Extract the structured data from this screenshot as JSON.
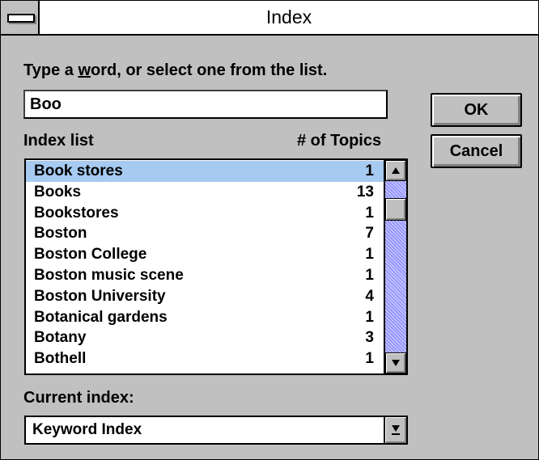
{
  "window": {
    "title": "Index"
  },
  "prompt": {
    "before": "Type a ",
    "accel": "w",
    "after": "ord, or select one from the list."
  },
  "search": {
    "value": "Boo"
  },
  "buttons": {
    "ok": "OK",
    "cancel": "Cancel"
  },
  "list_header": {
    "left": "Index list",
    "right": "# of Topics"
  },
  "index_list": [
    {
      "name": "Book stores",
      "count": "1",
      "selected": true
    },
    {
      "name": "Books",
      "count": "13"
    },
    {
      "name": "Bookstores",
      "count": "1"
    },
    {
      "name": "Boston",
      "count": "7"
    },
    {
      "name": "Boston College",
      "count": "1"
    },
    {
      "name": "Boston music scene",
      "count": "1"
    },
    {
      "name": "Boston University",
      "count": "4"
    },
    {
      "name": "Botanical gardens",
      "count": "1"
    },
    {
      "name": "Botany",
      "count": "3"
    },
    {
      "name": "Bothell",
      "count": "1"
    }
  ],
  "current_index": {
    "label": "Current index:",
    "value": "Keyword Index"
  },
  "icons": {
    "system_menu": "minus-bar-icon",
    "scroll_up": "arrow-up-icon",
    "scroll_down": "arrow-down-icon",
    "dropdown": "arrow-down-underline-icon"
  },
  "colors": {
    "dialog_bg": "#c0c0c0",
    "selection": "#a6caf0",
    "scroll_track": "#8080ff"
  }
}
